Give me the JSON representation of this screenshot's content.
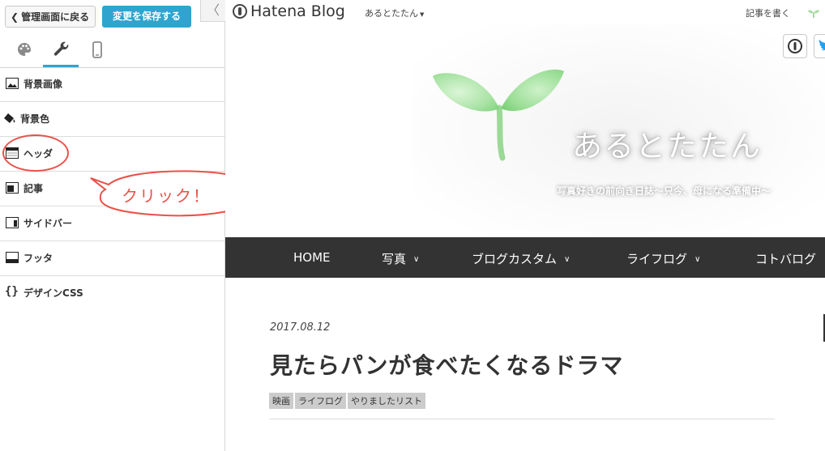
{
  "editor": {
    "back_label": "管理画面に戻る",
    "save_label": "変更を保存する",
    "collapse_icon": "chevron-left-icon",
    "tabs": [
      {
        "name": "palette",
        "icon": "palette-icon",
        "active": false
      },
      {
        "name": "wrench",
        "icon": "wrench-icon",
        "active": true
      },
      {
        "name": "mobile",
        "icon": "mobile-icon",
        "active": false
      }
    ],
    "menu": [
      {
        "label": "背景画像",
        "icon": "image-icon"
      },
      {
        "label": "背景色",
        "icon": "paint-bucket-icon"
      },
      {
        "label": "ヘッダ",
        "icon": "header-layout-icon"
      },
      {
        "label": "記事",
        "icon": "article-layout-icon"
      },
      {
        "label": "サイドバー",
        "icon": "sidebar-layout-icon"
      },
      {
        "label": "フッタ",
        "icon": "footer-layout-icon"
      },
      {
        "label": "デザインCSS",
        "icon": "braces-icon"
      }
    ],
    "accent_color": "#2fa4cf"
  },
  "annotation": {
    "callout_text": "クリック！",
    "color": "#e8524a"
  },
  "blog": {
    "hatena_logo": "Hatena Blog",
    "blog_switch": "あるとたたん",
    "write_label": "記事を書く",
    "title": "あるとたたん",
    "description": "写真好きの前向き日誌～只今、母になる準備中～",
    "nav": [
      {
        "label": "HOME",
        "dropdown": false
      },
      {
        "label": "写真",
        "dropdown": true
      },
      {
        "label": "ブログカスタム",
        "dropdown": true
      },
      {
        "label": "ライフログ",
        "dropdown": true
      },
      {
        "label": "コトバログ",
        "dropdown": false
      }
    ],
    "post": {
      "date": "2017.08.12",
      "title": "見たらパンが食べたくなるドラマ",
      "tags": [
        "映画",
        "ライフログ",
        "やりましたリスト"
      ]
    },
    "nav_bg": "#333333"
  }
}
